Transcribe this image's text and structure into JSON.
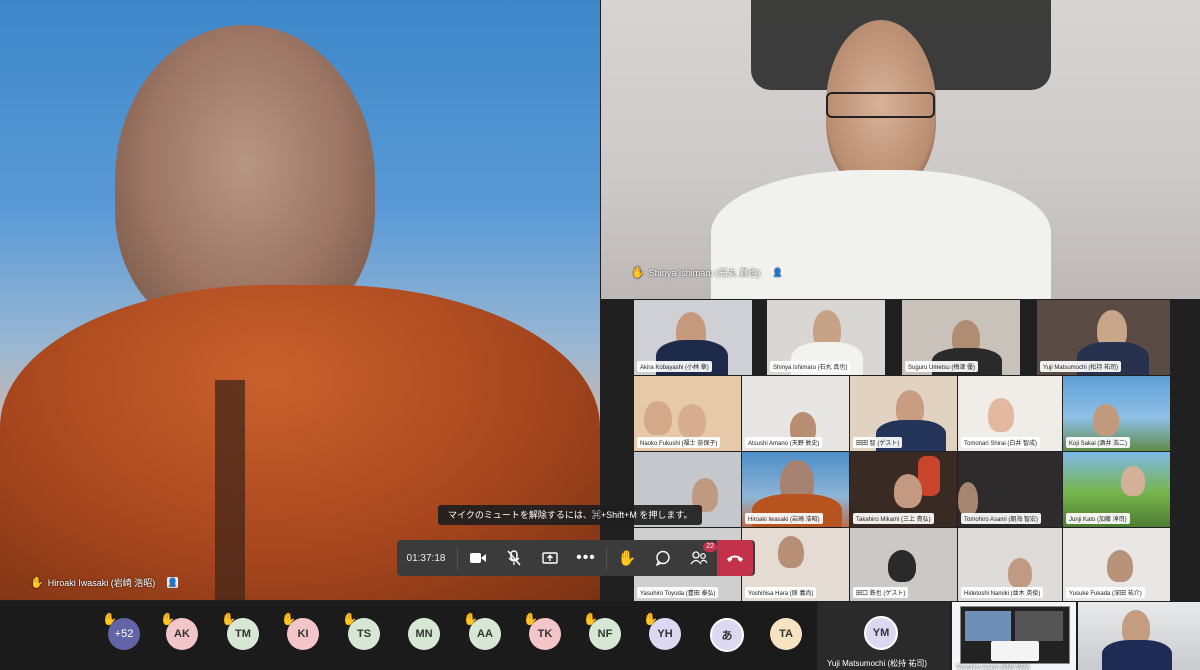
{
  "main_speaker": {
    "name": "Hiroaki Iwasaki (岩崎 浩昭)"
  },
  "top_right_speaker": {
    "name": "Shinya Ishimaru (石丸 真也)"
  },
  "gallery": [
    {
      "name": "Akira Kobayashi (小林 章)"
    },
    {
      "name": "Shinya Ishimaru (石丸 真也)"
    },
    {
      "name": "Suguru Umetsu (梅津 優)"
    },
    {
      "name": "Yuji Matsumochi (松持 祐司)"
    },
    {
      "name": "Naoko Fukushi (福士 奈保子)"
    },
    {
      "name": "Atsushi Amano (天野 敦史)"
    },
    {
      "name": "田田 智 (ゲスト)"
    },
    {
      "name": "Tomonari Shirai (白井 智成)"
    },
    {
      "name": "Koji Sakai (酒井 浩二)"
    },
    {
      "name": "Hiroaki Iwasaki (岩崎 浩昭)"
    },
    {
      "name": "Takahiro Mikami (三上 貴弘)"
    },
    {
      "name": "Tomohiro Asami (朝海 智宏)"
    },
    {
      "name": "Junji Kato (加藤 淳司)"
    },
    {
      "name": "Yasuhiro Toyoda (豊田 泰弘)"
    },
    {
      "name": "Yoshihisa Hara (原 義尚)"
    },
    {
      "name": "田口 鉄也 (ゲスト)"
    },
    {
      "name": "Hidetoshi Namiki (並木 英俊)"
    },
    {
      "name": "Yusuke Fukada (深田 祐介)"
    }
  ],
  "tooltip": "マイクのミュートを解除するには、⌘+Shift+M を押します。",
  "controls": {
    "timer": "01:37:18",
    "participants_count": "22"
  },
  "roster": {
    "overflow": "+52",
    "avatars": [
      {
        "initials": "AK",
        "color": "#f3c4c8",
        "hand": true
      },
      {
        "initials": "TM",
        "color": "#d6e8d4",
        "hand": true
      },
      {
        "initials": "KI",
        "color": "#f3c4c8",
        "hand": true
      },
      {
        "initials": "TS",
        "color": "#d6e8d4",
        "hand": true
      },
      {
        "initials": "MN",
        "color": "#d6e8d4",
        "hand": false
      },
      {
        "initials": "AA",
        "color": "#d6e8d4",
        "hand": true
      },
      {
        "initials": "TK",
        "color": "#f3c4c8",
        "hand": true
      },
      {
        "initials": "NF",
        "color": "#d6e8d4",
        "hand": true
      },
      {
        "initials": "YH",
        "color": "#dcd8f2",
        "hand": true
      },
      {
        "initials": "あ",
        "color": "#dcd8f2",
        "hand": false
      },
      {
        "initials": "TA",
        "color": "#f7e2c2",
        "hand": false
      }
    ],
    "featured": {
      "initials": "YM",
      "name": "Yuji Matsumochi (松持 祐司)"
    }
  },
  "share_preview_label": "Tomohiro Asami (朝海 智宏)",
  "colors": {
    "accent": "#6264a7",
    "hangup": "#c4314b",
    "hand": "#f5c542"
  }
}
